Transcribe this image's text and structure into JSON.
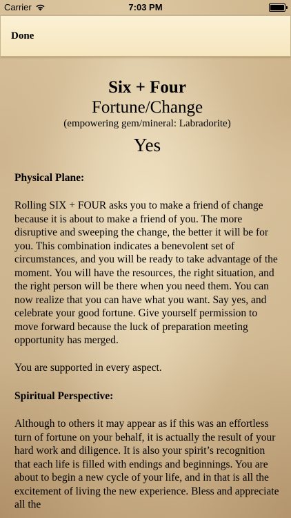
{
  "status_bar": {
    "carrier": "Carrier",
    "time": "7:03 PM"
  },
  "header": {
    "done_label": "Done"
  },
  "reading": {
    "title": "Six + Four",
    "subtitle": "Fortune/Change",
    "gem_line": "(empowering gem/mineral: Labradorite)",
    "answer": "Yes",
    "physical_heading": "Physical Plane:",
    "physical_text": "Rolling SIX + FOUR asks you to make a friend of change because it is about to make a friend of you. The more disruptive and sweeping the change, the better it will be for you.  This combination indicates a benevolent set of circumstances, and you will be ready to take advantage of the moment.  You will have the resources, the right situation, and the right person will be there when you need them. You can now realize that you can have what you want.  Say yes, and celebrate your good fortune.  Give yourself permission to move forward because the luck of preparation meeting opportunity has merged.",
    "support_text": "You are supported in every aspect.",
    "spiritual_heading": "Spiritual Perspective:",
    "spiritual_text": "Although to others it may appear as if this was an effortless turn of fortune on your behalf, it is actually the result of your hard work and diligence.  It is also your spirit’s recognition that each life is filled with endings and beginnings.  You are about to begin a new cycle of your life, and in that is all the excitement of living the new experience.  Bless and appreciate all the"
  }
}
